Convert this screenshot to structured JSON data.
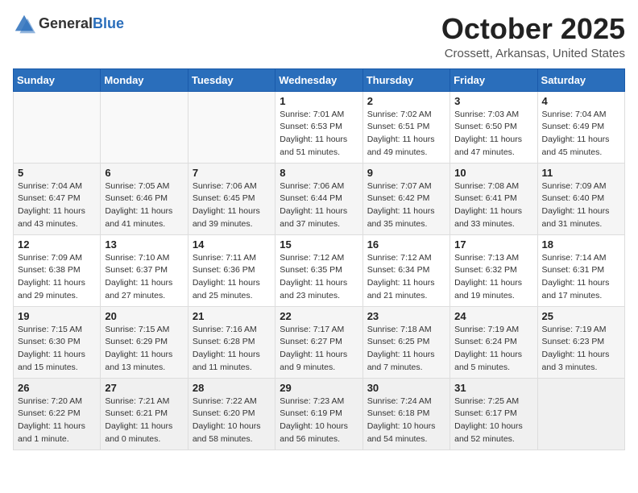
{
  "logo": {
    "general": "General",
    "blue": "Blue"
  },
  "title": "October 2025",
  "location": "Crossett, Arkansas, United States",
  "weekdays": [
    "Sunday",
    "Monday",
    "Tuesday",
    "Wednesday",
    "Thursday",
    "Friday",
    "Saturday"
  ],
  "weeks": [
    [
      {
        "day": "",
        "info": ""
      },
      {
        "day": "",
        "info": ""
      },
      {
        "day": "",
        "info": ""
      },
      {
        "day": "1",
        "info": "Sunrise: 7:01 AM\nSunset: 6:53 PM\nDaylight: 11 hours\nand 51 minutes."
      },
      {
        "day": "2",
        "info": "Sunrise: 7:02 AM\nSunset: 6:51 PM\nDaylight: 11 hours\nand 49 minutes."
      },
      {
        "day": "3",
        "info": "Sunrise: 7:03 AM\nSunset: 6:50 PM\nDaylight: 11 hours\nand 47 minutes."
      },
      {
        "day": "4",
        "info": "Sunrise: 7:04 AM\nSunset: 6:49 PM\nDaylight: 11 hours\nand 45 minutes."
      }
    ],
    [
      {
        "day": "5",
        "info": "Sunrise: 7:04 AM\nSunset: 6:47 PM\nDaylight: 11 hours\nand 43 minutes."
      },
      {
        "day": "6",
        "info": "Sunrise: 7:05 AM\nSunset: 6:46 PM\nDaylight: 11 hours\nand 41 minutes."
      },
      {
        "day": "7",
        "info": "Sunrise: 7:06 AM\nSunset: 6:45 PM\nDaylight: 11 hours\nand 39 minutes."
      },
      {
        "day": "8",
        "info": "Sunrise: 7:06 AM\nSunset: 6:44 PM\nDaylight: 11 hours\nand 37 minutes."
      },
      {
        "day": "9",
        "info": "Sunrise: 7:07 AM\nSunset: 6:42 PM\nDaylight: 11 hours\nand 35 minutes."
      },
      {
        "day": "10",
        "info": "Sunrise: 7:08 AM\nSunset: 6:41 PM\nDaylight: 11 hours\nand 33 minutes."
      },
      {
        "day": "11",
        "info": "Sunrise: 7:09 AM\nSunset: 6:40 PM\nDaylight: 11 hours\nand 31 minutes."
      }
    ],
    [
      {
        "day": "12",
        "info": "Sunrise: 7:09 AM\nSunset: 6:38 PM\nDaylight: 11 hours\nand 29 minutes."
      },
      {
        "day": "13",
        "info": "Sunrise: 7:10 AM\nSunset: 6:37 PM\nDaylight: 11 hours\nand 27 minutes."
      },
      {
        "day": "14",
        "info": "Sunrise: 7:11 AM\nSunset: 6:36 PM\nDaylight: 11 hours\nand 25 minutes."
      },
      {
        "day": "15",
        "info": "Sunrise: 7:12 AM\nSunset: 6:35 PM\nDaylight: 11 hours\nand 23 minutes."
      },
      {
        "day": "16",
        "info": "Sunrise: 7:12 AM\nSunset: 6:34 PM\nDaylight: 11 hours\nand 21 minutes."
      },
      {
        "day": "17",
        "info": "Sunrise: 7:13 AM\nSunset: 6:32 PM\nDaylight: 11 hours\nand 19 minutes."
      },
      {
        "day": "18",
        "info": "Sunrise: 7:14 AM\nSunset: 6:31 PM\nDaylight: 11 hours\nand 17 minutes."
      }
    ],
    [
      {
        "day": "19",
        "info": "Sunrise: 7:15 AM\nSunset: 6:30 PM\nDaylight: 11 hours\nand 15 minutes."
      },
      {
        "day": "20",
        "info": "Sunrise: 7:15 AM\nSunset: 6:29 PM\nDaylight: 11 hours\nand 13 minutes."
      },
      {
        "day": "21",
        "info": "Sunrise: 7:16 AM\nSunset: 6:28 PM\nDaylight: 11 hours\nand 11 minutes."
      },
      {
        "day": "22",
        "info": "Sunrise: 7:17 AM\nSunset: 6:27 PM\nDaylight: 11 hours\nand 9 minutes."
      },
      {
        "day": "23",
        "info": "Sunrise: 7:18 AM\nSunset: 6:25 PM\nDaylight: 11 hours\nand 7 minutes."
      },
      {
        "day": "24",
        "info": "Sunrise: 7:19 AM\nSunset: 6:24 PM\nDaylight: 11 hours\nand 5 minutes."
      },
      {
        "day": "25",
        "info": "Sunrise: 7:19 AM\nSunset: 6:23 PM\nDaylight: 11 hours\nand 3 minutes."
      }
    ],
    [
      {
        "day": "26",
        "info": "Sunrise: 7:20 AM\nSunset: 6:22 PM\nDaylight: 11 hours\nand 1 minute."
      },
      {
        "day": "27",
        "info": "Sunrise: 7:21 AM\nSunset: 6:21 PM\nDaylight: 11 hours\nand 0 minutes."
      },
      {
        "day": "28",
        "info": "Sunrise: 7:22 AM\nSunset: 6:20 PM\nDaylight: 10 hours\nand 58 minutes."
      },
      {
        "day": "29",
        "info": "Sunrise: 7:23 AM\nSunset: 6:19 PM\nDaylight: 10 hours\nand 56 minutes."
      },
      {
        "day": "30",
        "info": "Sunrise: 7:24 AM\nSunset: 6:18 PM\nDaylight: 10 hours\nand 54 minutes."
      },
      {
        "day": "31",
        "info": "Sunrise: 7:25 AM\nSunset: 6:17 PM\nDaylight: 10 hours\nand 52 minutes."
      },
      {
        "day": "",
        "info": ""
      }
    ]
  ]
}
